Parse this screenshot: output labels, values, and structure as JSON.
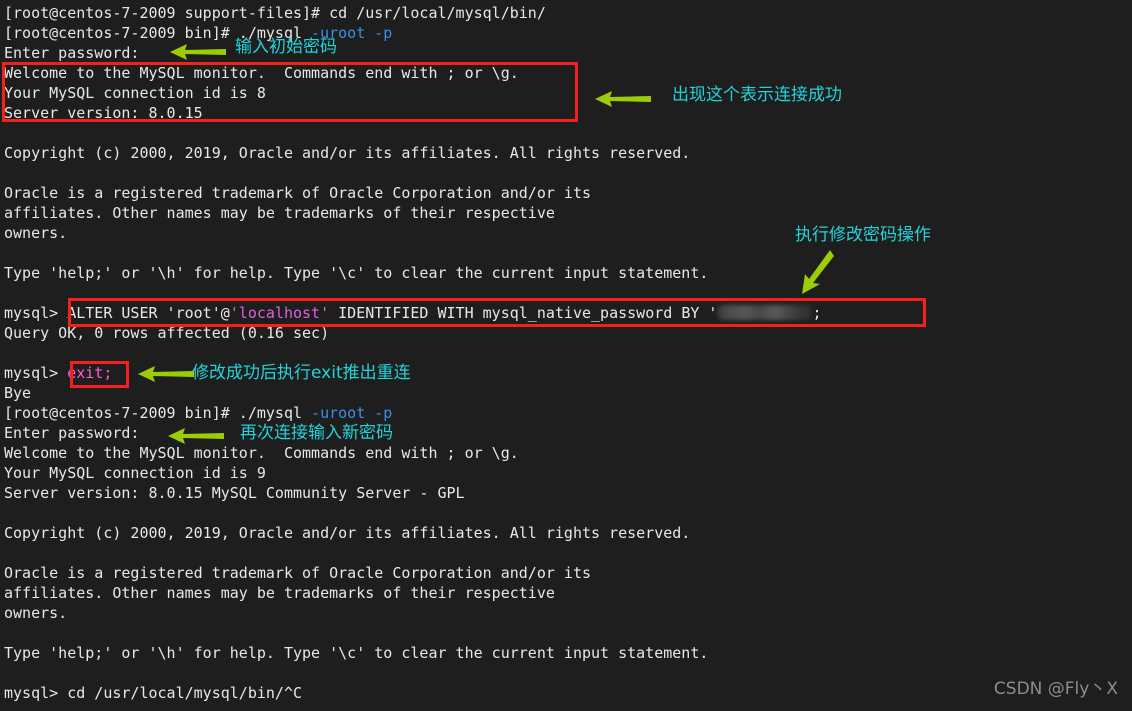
{
  "terminal": {
    "background_color": "#1e1e1e",
    "foreground_color": "#e8e8e8",
    "accent_blue": "#3b8eea",
    "accent_magenta": "#e05fe0",
    "box_color": "#f4201c",
    "arrow_color": "#9acd06",
    "annotation_color": "#22d3d8",
    "lines": [
      {
        "id": "l01",
        "segments": [
          {
            "text": "[root@centos-7-2009 support-files]# cd /usr/local/mysql/bin/",
            "color": "white"
          }
        ]
      },
      {
        "id": "l02",
        "segments": [
          {
            "text": "[root@centos-7-2009 bin]# ./mysql ",
            "color": "white"
          },
          {
            "text": "-uroot -p",
            "color": "blue"
          }
        ]
      },
      {
        "id": "l03",
        "segments": [
          {
            "text": "Enter password: ",
            "color": "white"
          }
        ]
      },
      {
        "id": "l04",
        "segments": [
          {
            "text": "Welcome to the MySQL monitor.  Commands end with ; or \\g.",
            "color": "white"
          }
        ]
      },
      {
        "id": "l05",
        "segments": [
          {
            "text": "Your MySQL connection id is 8",
            "color": "white"
          }
        ]
      },
      {
        "id": "l06",
        "segments": [
          {
            "text": "Server version: 8.0.15",
            "color": "white"
          }
        ]
      },
      {
        "id": "l07",
        "blank": true
      },
      {
        "id": "l08",
        "segments": [
          {
            "text": "Copyright (c) 2000, 2019, Oracle and/or its affiliates. All rights reserved.",
            "color": "white"
          }
        ]
      },
      {
        "id": "l09",
        "blank": true
      },
      {
        "id": "l10",
        "segments": [
          {
            "text": "Oracle is a registered trademark of Oracle Corporation and/or its",
            "color": "white"
          }
        ]
      },
      {
        "id": "l11",
        "segments": [
          {
            "text": "affiliates. Other names may be trademarks of their respective",
            "color": "white"
          }
        ]
      },
      {
        "id": "l12",
        "segments": [
          {
            "text": "owners.",
            "color": "white"
          }
        ]
      },
      {
        "id": "l13",
        "blank": true
      },
      {
        "id": "l14",
        "segments": [
          {
            "text": "Type 'help;' or '\\h' for help. Type '\\c' to clear the current input statement.",
            "color": "white"
          }
        ]
      },
      {
        "id": "l15",
        "blank": true
      },
      {
        "id": "l16",
        "segments": [
          {
            "text": "mysql> ",
            "color": "white"
          },
          {
            "text": "ALTER USER 'root'@",
            "color": "white"
          },
          {
            "text": "'localhost'",
            "color": "magenta"
          },
          {
            "text": " IDENTIFIED WITH mysql_native_password BY '",
            "color": "white"
          },
          {
            "redacted": true
          },
          {
            "text": ";",
            "color": "white"
          }
        ]
      },
      {
        "id": "l17",
        "segments": [
          {
            "text": "Query OK, 0 rows affected (0.16 sec)",
            "color": "white"
          }
        ]
      },
      {
        "id": "l18",
        "blank": true
      },
      {
        "id": "l19",
        "segments": [
          {
            "text": "mysql> ",
            "color": "white"
          },
          {
            "text": "exit;",
            "color": "pink"
          }
        ]
      },
      {
        "id": "l20",
        "segments": [
          {
            "text": "Bye",
            "color": "white"
          }
        ]
      },
      {
        "id": "l21",
        "segments": [
          {
            "text": "[root@centos-7-2009 bin]# ./mysql ",
            "color": "white"
          },
          {
            "text": "-uroot -p",
            "color": "blue"
          }
        ]
      },
      {
        "id": "l22",
        "segments": [
          {
            "text": "Enter password: ",
            "color": "white"
          }
        ]
      },
      {
        "id": "l23",
        "segments": [
          {
            "text": "Welcome to the MySQL monitor.  Commands end with ; or \\g.",
            "color": "white"
          }
        ]
      },
      {
        "id": "l24",
        "segments": [
          {
            "text": "Your MySQL connection id is 9",
            "color": "white"
          }
        ]
      },
      {
        "id": "l25",
        "segments": [
          {
            "text": "Server version: 8.0.15 MySQL Community Server - GPL",
            "color": "white"
          }
        ]
      },
      {
        "id": "l26",
        "blank": true
      },
      {
        "id": "l27",
        "segments": [
          {
            "text": "Copyright (c) 2000, 2019, Oracle and/or its affiliates. All rights reserved.",
            "color": "white"
          }
        ]
      },
      {
        "id": "l28",
        "blank": true
      },
      {
        "id": "l29",
        "segments": [
          {
            "text": "Oracle is a registered trademark of Oracle Corporation and/or its",
            "color": "white"
          }
        ]
      },
      {
        "id": "l30",
        "segments": [
          {
            "text": "affiliates. Other names may be trademarks of their respective",
            "color": "white"
          }
        ]
      },
      {
        "id": "l31",
        "segments": [
          {
            "text": "owners.",
            "color": "white"
          }
        ]
      },
      {
        "id": "l32",
        "blank": true
      },
      {
        "id": "l33",
        "segments": [
          {
            "text": "Type 'help;' or '\\h' for help. Type '\\c' to clear the current input statement.",
            "color": "white"
          }
        ]
      },
      {
        "id": "l34",
        "blank": true
      },
      {
        "id": "l35",
        "segments": [
          {
            "text": "mysql> cd /usr/local/mysql/bin/^C",
            "color": "white"
          }
        ]
      }
    ]
  },
  "annotations": {
    "enter_initial_password": "输入初始密码",
    "connection_success": "出现这个表示连接成功",
    "change_password_op": "执行修改密码操作",
    "exit_and_reconnect": "修改成功后执行exit推出重连",
    "reconnect_new_password": "再次连接输入新密码"
  },
  "watermark": {
    "text": "CSDN @Fly丶X"
  }
}
